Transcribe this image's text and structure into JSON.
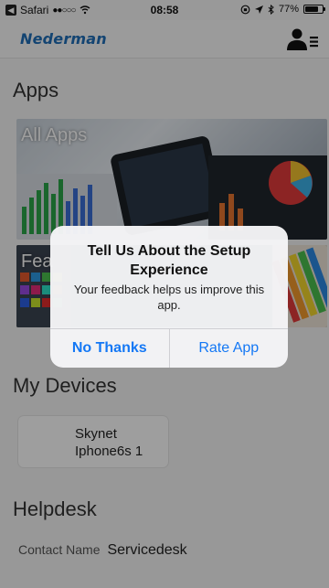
{
  "status_bar": {
    "carrier": "Safari",
    "signal": "●●○○○",
    "time": "08:58",
    "battery": "77%",
    "battery_level": 0.77
  },
  "header": {
    "logo_text": "Nederman",
    "profile_menu_icon": "user-menu-icon"
  },
  "apps": {
    "title": "Apps",
    "tiles": [
      {
        "label": "All Apps"
      },
      {
        "label": "Fea"
      }
    ]
  },
  "devices": {
    "title": "My Devices",
    "items": [
      {
        "name": "Skynet\nIphone6s 1"
      }
    ]
  },
  "helpdesk": {
    "title": "Helpdesk",
    "contact_label": "Contact Name",
    "contact_value": "Servicedesk"
  },
  "alert": {
    "title": "Tell Us About the Setup Experience",
    "message": "Your feedback helps us improve this app.",
    "buttons": [
      {
        "label": "No Thanks"
      },
      {
        "label": "Rate App"
      }
    ]
  },
  "colors": {
    "accent": "#1478f5",
    "logo": "#1f6fb8"
  }
}
